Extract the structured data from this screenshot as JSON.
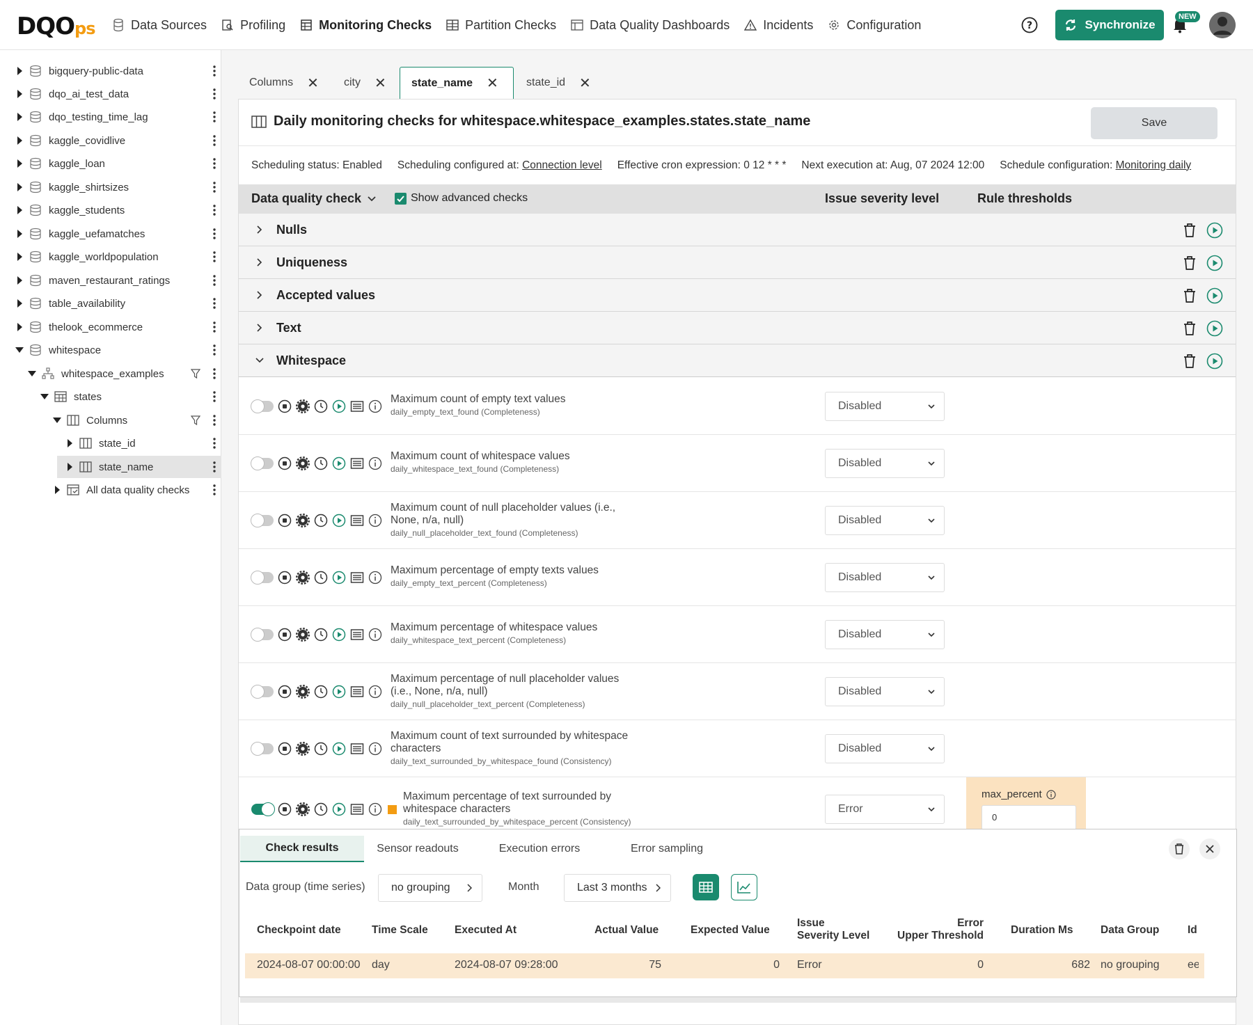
{
  "header": {
    "logo_main": "DQO",
    "logo_sub": "ps",
    "nav": [
      {
        "label": "Data Sources",
        "icon": "database-icon"
      },
      {
        "label": "Profiling",
        "icon": "profiling-icon"
      },
      {
        "label": "Monitoring Checks",
        "icon": "table-icon"
      },
      {
        "label": "Partition Checks",
        "icon": "partition-icon"
      },
      {
        "label": "Data Quality Dashboards",
        "icon": "dashboard-icon"
      },
      {
        "label": "Incidents",
        "icon": "warning-icon"
      },
      {
        "label": "Configuration",
        "icon": "gear-icon"
      }
    ],
    "sync_label": "Synchronize",
    "new_badge": "NEW"
  },
  "sidebar": {
    "items": [
      {
        "label": "bigquery-public-data"
      },
      {
        "label": "dqo_ai_test_data"
      },
      {
        "label": "dqo_testing_time_lag"
      },
      {
        "label": "kaggle_covidlive"
      },
      {
        "label": "kaggle_loan"
      },
      {
        "label": "kaggle_shirtsizes"
      },
      {
        "label": "kaggle_students"
      },
      {
        "label": "kaggle_uefamatches"
      },
      {
        "label": "kaggle_worldpopulation"
      },
      {
        "label": "maven_restaurant_ratings"
      },
      {
        "label": "table_availability"
      },
      {
        "label": "thelook_ecommerce"
      },
      {
        "label": "whitespace"
      },
      {
        "label": "whitespace_examples"
      },
      {
        "label": "states"
      },
      {
        "label": "Columns"
      },
      {
        "label": "state_id"
      },
      {
        "label": "state_name"
      },
      {
        "label": "All data quality checks"
      }
    ]
  },
  "tabs": [
    {
      "label": "Columns"
    },
    {
      "label": "city"
    },
    {
      "label": "state_name"
    },
    {
      "label": "state_id"
    }
  ],
  "panel": {
    "title": "Daily monitoring checks for whitespace.whitespace_examples.states.state_name",
    "save_label": "Save",
    "scheduling": {
      "status": "Scheduling status: Enabled",
      "configured_prefix": "Scheduling configured at:",
      "configured_link": "Connection level",
      "cron": "Effective cron expression: 0 12 * * *",
      "next": "Next execution at: Aug, 07 2024 12:00",
      "config_prefix": "Schedule configuration:",
      "config_link": "Monitoring daily"
    },
    "columns": {
      "check": "Data quality check",
      "advanced": "Show advanced checks",
      "severity": "Issue severity level",
      "thresholds": "Rule thresholds"
    },
    "categories": [
      {
        "label": "Nulls"
      },
      {
        "label": "Uniqueness"
      },
      {
        "label": "Accepted values"
      },
      {
        "label": "Text"
      },
      {
        "label": "Whitespace"
      }
    ],
    "checks": [
      {
        "name": "Maximum count of empty text values",
        "name2": "",
        "code": "daily_empty_text_found (Completeness)",
        "severity": "Disabled"
      },
      {
        "name": "Maximum count of whitespace values",
        "name2": "",
        "code": "daily_whitespace_text_found (Completeness)",
        "severity": "Disabled"
      },
      {
        "name": "Maximum count of null placeholder values (i.e.,",
        "name2": "None, n/a, null)",
        "code": "daily_null_placeholder_text_found (Completeness)",
        "severity": "Disabled"
      },
      {
        "name": "Maximum percentage of empty texts values",
        "name2": "",
        "code": "daily_empty_text_percent (Completeness)",
        "severity": "Disabled"
      },
      {
        "name": "Maximum percentage of whitespace values",
        "name2": "",
        "code": "daily_whitespace_text_percent (Completeness)",
        "severity": "Disabled"
      },
      {
        "name": "Maximum percentage of null placeholder values",
        "name2": "(i.e., None, n/a, null)",
        "code": "daily_null_placeholder_text_percent (Completeness)",
        "severity": "Disabled"
      },
      {
        "name": "Maximum count of text surrounded by whitespace",
        "name2": "characters",
        "code": "daily_text_surrounded_by_whitespace_found (Consistency)",
        "severity": "Disabled"
      },
      {
        "name": "Maximum percentage of text surrounded by",
        "name2": "whitespace characters",
        "code": "daily_text_surrounded_by_whitespace_percent (Consistency)",
        "severity": "Error",
        "threshold_label": "max_percent",
        "threshold_value": "0"
      }
    ]
  },
  "results": {
    "tabs": [
      "Check results",
      "Sensor readouts",
      "Execution errors",
      "Error sampling"
    ],
    "data_group_label": "Data group (time series)",
    "data_group_value": "no grouping",
    "month_label": "Month",
    "month_value": "Last 3 months",
    "headers": {
      "checkpoint": "Checkpoint date",
      "timescale": "Time Scale",
      "executed": "Executed At",
      "actual": "Actual Value",
      "expected": "Expected Value",
      "issue1": "Issue",
      "issue2": "Severity Level",
      "err1": "Error",
      "err2": "Upper Threshold",
      "duration": "Duration Ms",
      "group": "Data Group",
      "id": "Id"
    },
    "row": {
      "checkpoint": "2024-08-07 00:00:00",
      "timescale": "day",
      "executed": "2024-08-07 09:28:00",
      "actual": "75",
      "expected": "0",
      "severity": "Error",
      "threshold": "0",
      "duration": "682",
      "group": "no grouping",
      "id": "ee"
    }
  },
  "colors": {
    "accent": "#1a8a6e",
    "brand_orange": "#f39c12",
    "highlight": "#fbe9d1",
    "severity_error": "#f39c12"
  }
}
